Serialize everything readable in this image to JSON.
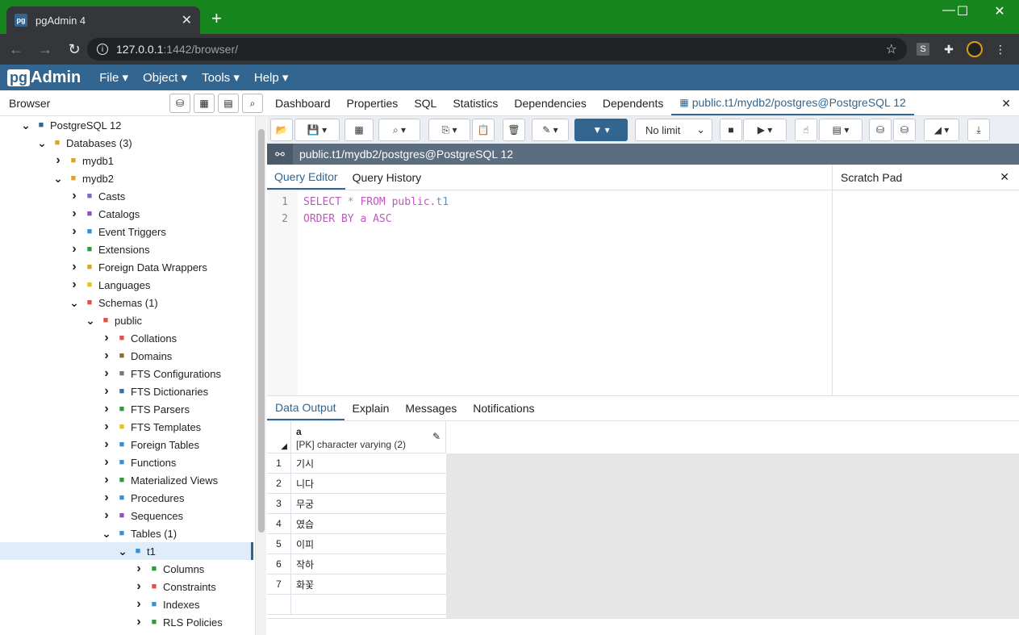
{
  "chrome": {
    "tab_title": "pgAdmin 4",
    "tab_favicon": "pg",
    "new_tab": "+",
    "url_host": "127.0.0.1",
    "url_rest": ":1442/browser/",
    "ext_s": "S"
  },
  "menubar": {
    "logo_pg": "pg",
    "logo_admin": "Admin",
    "items": [
      "File ▾",
      "Object ▾",
      "Tools ▾",
      "Help ▾"
    ]
  },
  "browser": {
    "title": "Browser",
    "tree": [
      {
        "label": "PostgreSQL 12",
        "depth": 1,
        "toggle": "v",
        "icon": "server-icon",
        "color": "#336791"
      },
      {
        "label": "Databases (3)",
        "depth": 2,
        "toggle": "v",
        "icon": "databases-icon",
        "color": "#d4a72c"
      },
      {
        "label": "mydb1",
        "depth": 3,
        "toggle": ">",
        "icon": "database-icon",
        "color": "#d4a72c"
      },
      {
        "label": "mydb2",
        "depth": 3,
        "toggle": "v",
        "icon": "database-icon",
        "color": "#d4a72c"
      },
      {
        "label": "Casts",
        "depth": 4,
        "toggle": ">",
        "icon": "casts-icon",
        "color": "#7b68c9"
      },
      {
        "label": "Catalogs",
        "depth": 4,
        "toggle": ">",
        "icon": "catalogs-icon",
        "color": "#8b54b8"
      },
      {
        "label": "Event Triggers",
        "depth": 4,
        "toggle": ">",
        "icon": "event-triggers-icon",
        "color": "#3a8fd1"
      },
      {
        "label": "Extensions",
        "depth": 4,
        "toggle": ">",
        "icon": "extensions-icon",
        "color": "#2f9a3e"
      },
      {
        "label": "Foreign Data Wrappers",
        "depth": 4,
        "toggle": ">",
        "icon": "fdw-icon",
        "color": "#d4a72c"
      },
      {
        "label": "Languages",
        "depth": 4,
        "toggle": ">",
        "icon": "languages-icon",
        "color": "#e2c324"
      },
      {
        "label": "Schemas (1)",
        "depth": 4,
        "toggle": "v",
        "icon": "schemas-icon",
        "color": "#d9534f"
      },
      {
        "label": "public",
        "depth": 5,
        "toggle": "v",
        "icon": "schema-icon",
        "color": "#d9534f"
      },
      {
        "label": "Collations",
        "depth": 6,
        "toggle": ">",
        "icon": "collations-icon",
        "color": "#d9534f"
      },
      {
        "label": "Domains",
        "depth": 6,
        "toggle": ">",
        "icon": "domains-icon",
        "color": "#8a6d3b"
      },
      {
        "label": "FTS Configurations",
        "depth": 6,
        "toggle": ">",
        "icon": "fts-config-icon",
        "color": "#777777"
      },
      {
        "label": "FTS Dictionaries",
        "depth": 6,
        "toggle": ">",
        "icon": "fts-dict-icon",
        "color": "#3a6ea5"
      },
      {
        "label": "FTS Parsers",
        "depth": 6,
        "toggle": ">",
        "icon": "fts-parser-icon",
        "color": "#2f9a3e"
      },
      {
        "label": "FTS Templates",
        "depth": 6,
        "toggle": ">",
        "icon": "fts-template-icon",
        "color": "#e2c324"
      },
      {
        "label": "Foreign Tables",
        "depth": 6,
        "toggle": ">",
        "icon": "foreign-tables-icon",
        "color": "#3a8fd1"
      },
      {
        "label": "Functions",
        "depth": 6,
        "toggle": ">",
        "icon": "functions-icon",
        "color": "#3a8fd1"
      },
      {
        "label": "Materialized Views",
        "depth": 6,
        "toggle": ">",
        "icon": "mat-views-icon",
        "color": "#2f9a3e"
      },
      {
        "label": "Procedures",
        "depth": 6,
        "toggle": ">",
        "icon": "procedures-icon",
        "color": "#3a8fd1"
      },
      {
        "label": "Sequences",
        "depth": 6,
        "toggle": ">",
        "icon": "sequences-icon",
        "color": "#8b54b8"
      },
      {
        "label": "Tables (1)",
        "depth": 6,
        "toggle": "v",
        "icon": "tables-icon",
        "color": "#3a8fd1"
      },
      {
        "label": "t1",
        "depth": 7,
        "toggle": "v",
        "icon": "table-icon",
        "color": "#3a8fd1",
        "selected": true
      },
      {
        "label": "Columns",
        "depth": 8,
        "toggle": ">",
        "icon": "columns-icon",
        "color": "#2f9a3e"
      },
      {
        "label": "Constraints",
        "depth": 8,
        "toggle": ">",
        "icon": "constraints-icon",
        "color": "#d9534f"
      },
      {
        "label": "Indexes",
        "depth": 8,
        "toggle": ">",
        "icon": "indexes-icon",
        "color": "#3a8fd1"
      },
      {
        "label": "RLS Policies",
        "depth": 8,
        "toggle": ">",
        "icon": "rls-icon",
        "color": "#2f9a3e"
      }
    ]
  },
  "main_tabs": [
    "Dashboard",
    "Properties",
    "SQL",
    "Statistics",
    "Dependencies",
    "Dependents",
    "public.t1/mydb2/postgres@PostgreSQL 12"
  ],
  "toolbar": {
    "limit": "No limit"
  },
  "connection": "public.t1/mydb2/postgres@PostgreSQL 12",
  "query_tabs": [
    "Query Editor",
    "Query History"
  ],
  "scratch_pad": "Scratch Pad",
  "sql": {
    "line1": {
      "n": "1",
      "select": "SELECT",
      "star": " * ",
      "from": "FROM",
      "schema": " public.",
      "table": "t1"
    },
    "line2": {
      "n": "2",
      "order": "ORDER BY",
      "col": " a ",
      "asc": "ASC"
    }
  },
  "result_tabs": [
    "Data Output",
    "Explain",
    "Messages",
    "Notifications"
  ],
  "grid": {
    "column_name": "a",
    "column_type": "[PK] character varying (2)",
    "rows": [
      {
        "idx": "1",
        "val": "기시"
      },
      {
        "idx": "2",
        "val": "니다"
      },
      {
        "idx": "3",
        "val": "무궁"
      },
      {
        "idx": "4",
        "val": "였습"
      },
      {
        "idx": "5",
        "val": "이피"
      },
      {
        "idx": "6",
        "val": "작하"
      },
      {
        "idx": "7",
        "val": "화꽃"
      }
    ]
  }
}
